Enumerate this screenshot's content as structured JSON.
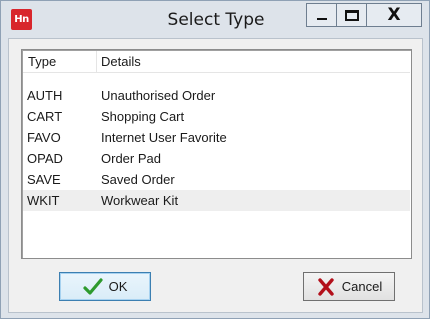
{
  "window": {
    "title": "Select Type",
    "app_icon_text": "Hn",
    "minimize_glyph": "",
    "close_glyph": "X"
  },
  "list": {
    "columns": {
      "type": "Type",
      "details": "Details"
    },
    "rows": [
      {
        "type": "AUTH",
        "details": "Unauthorised Order",
        "selected": false
      },
      {
        "type": "CART",
        "details": "Shopping Cart",
        "selected": false
      },
      {
        "type": "FAVO",
        "details": "Internet User Favorite",
        "selected": false
      },
      {
        "type": "OPAD",
        "details": "Order Pad",
        "selected": false
      },
      {
        "type": "SAVE",
        "details": "Saved Order",
        "selected": false
      },
      {
        "type": "WKIT",
        "details": "Workwear Kit",
        "selected": true
      }
    ]
  },
  "buttons": {
    "ok": {
      "label": "OK",
      "icon": "green-checkmark-icon"
    },
    "cancel": {
      "label": "Cancel",
      "icon": "red-x-icon"
    }
  },
  "colors": {
    "app_icon_bg": "#d8262c",
    "check_green": "#2e9a2e",
    "cancel_red": "#b3101b"
  }
}
